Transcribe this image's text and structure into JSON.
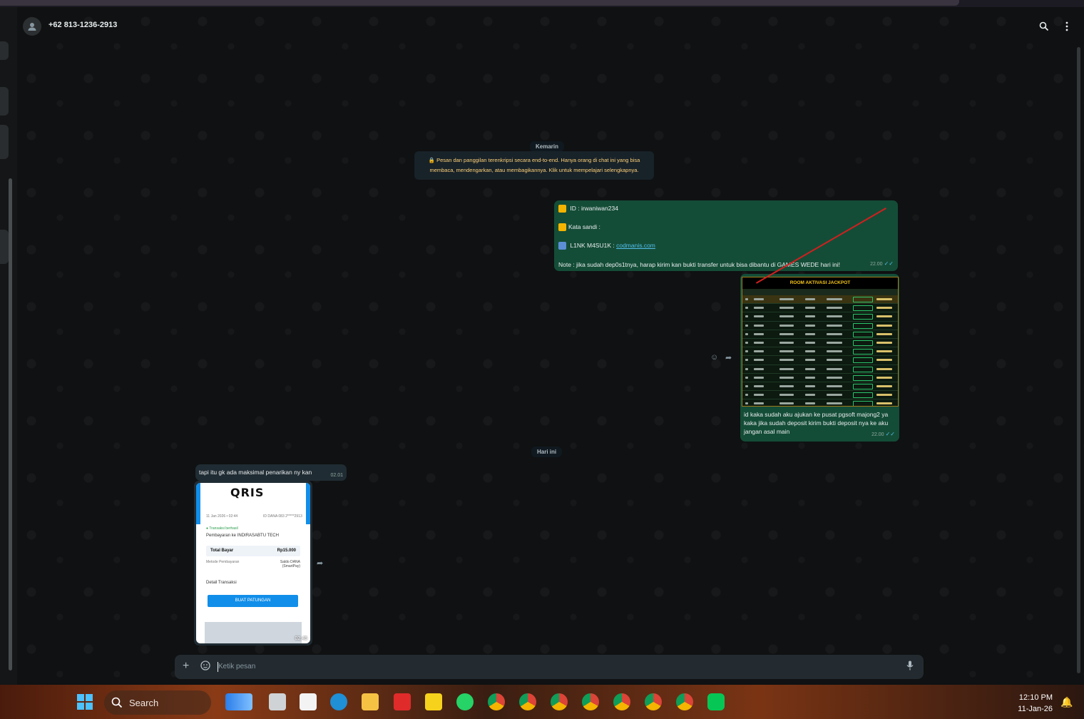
{
  "chat": {
    "contact_name": "+62 813-1236-2913",
    "date_yesterday": "Kemarin",
    "date_today": "Hari ini",
    "encryption_notice": "🔒 Pesan dan panggilan terenkripsi secara end-to-end. Hanya orang di chat ini yang bisa membaca, mendengarkan, atau membagikannya. Klik untuk mempelajari selengkapnya.",
    "messages": {
      "m1": {
        "id_line": " ID :  irwaniwan234",
        "password_line": "Kata sandi :",
        "link_label": " L1NK M4SU1K : ",
        "link_text": "codmanis.com",
        "note": "Note : jika sudah dep0s1tnya, harap kirim kan bukti transfer untuk bisa dibantu di GAMES WEDE hari ini!",
        "time": "22.00"
      },
      "m2": {
        "image_title": "ROOM AKTIVASI JACKPOT",
        "caption": "id kaka sudah aku ajukan ke pusat pgsoft majong2 ya kaka jika sudah deposit kirim bukti deposit nya ke aku jangan asal main",
        "time": "22.00"
      },
      "m3": {
        "text": "tapi itu gk ada maksimal penarikan ny kan",
        "time": "02.01"
      },
      "m4": {
        "qris_logo": "QRIS",
        "date": "11 Jan 2026 • 02:44",
        "id_dana": "ID DANA 083 2*****2913",
        "success": "Transaksi berhasil",
        "pay_to": "Pembayaran ke INDIRASABTU TECH",
        "total_label": "Total Bayar",
        "total_value": "Rp15.000",
        "method_label": "Metode Pembayaran",
        "method_value": "Saldo DANA (SmartPay)",
        "detail_label": "Detail Transaksi",
        "button": "BUAT PATUNGAN",
        "time": "02.45"
      }
    },
    "composer_placeholder": "Ketik pesan"
  },
  "taskbar": {
    "search_label": "Search",
    "time": "12:10 PM",
    "date": "11-Jan-26"
  },
  "colors": {
    "outgoing_bubble": "#144d37",
    "incoming_bubble": "#202c33",
    "accent_link": "#53bdeb",
    "notice_text": "#ffd279"
  }
}
